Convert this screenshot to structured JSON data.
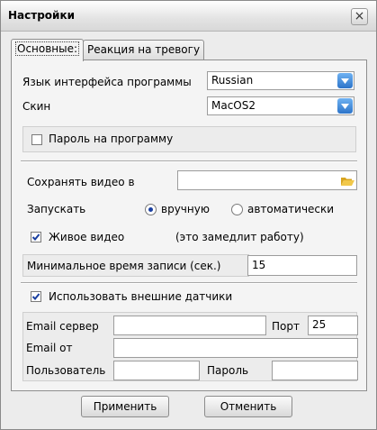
{
  "window": {
    "title": "Настройки",
    "close_glyph": "×"
  },
  "tabs": [
    {
      "label": "Основные:",
      "active": true
    },
    {
      "label": "Реакция на тревогу",
      "active": false
    }
  ],
  "language": {
    "label": "Язык интерфейса программы",
    "value": "Russian"
  },
  "skin": {
    "label": "Скин",
    "value": "MacOS2"
  },
  "password_toggle": {
    "label": "Пароль на программу",
    "checked": false
  },
  "save_video": {
    "label": "Сохранять видео в",
    "value": ""
  },
  "launch": {
    "label": "Запускать",
    "options": [
      {
        "label": "вручную",
        "selected": true
      },
      {
        "label": "автоматически",
        "selected": false
      }
    ]
  },
  "live_video": {
    "label": "Живое видео",
    "checked": true,
    "note": "(это замедлит работу)"
  },
  "min_record": {
    "label": "Минимальное время записи (сек.)",
    "value": "15"
  },
  "external_sensors": {
    "label": "Использовать внешние датчики",
    "checked": true
  },
  "email": {
    "server_label": "Email сервер",
    "server_value": "",
    "port_label": "Порт",
    "port_value": "25",
    "from_label": "Email от",
    "from_value": "",
    "user_label": "Пользователь",
    "user_value": "",
    "password_label": "Пароль",
    "password_value": ""
  },
  "buttons": {
    "apply": "Применить",
    "cancel": "Отменить"
  },
  "colors": {
    "combo_button": "#2d74c9",
    "check_mark": "#1a3fa0",
    "folder": "#e8b830"
  }
}
